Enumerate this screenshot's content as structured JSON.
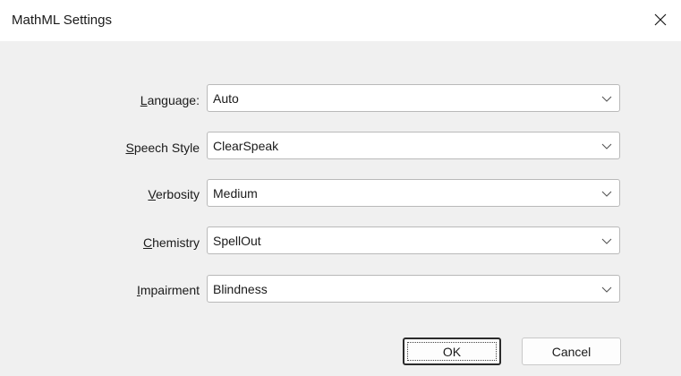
{
  "window": {
    "title": "MathML Settings"
  },
  "settings": [
    {
      "label_prefix": "",
      "label_key": "L",
      "label_rest": "anguage:",
      "value": "Auto"
    },
    {
      "label_prefix": "",
      "label_key": "S",
      "label_rest": "peech Style",
      "value": "ClearSpeak"
    },
    {
      "label_prefix": "",
      "label_key": "V",
      "label_rest": "erbosity",
      "value": "Medium"
    },
    {
      "label_prefix": "",
      "label_key": "C",
      "label_rest": "hemistry",
      "value": "SpellOut"
    },
    {
      "label_prefix": "",
      "label_key": "I",
      "label_rest": "mpairment",
      "value": "Blindness"
    }
  ],
  "buttons": {
    "ok": "OK",
    "cancel": "Cancel"
  },
  "icons": {
    "close": "close-icon",
    "dropdown": "chevron-down-icon"
  }
}
